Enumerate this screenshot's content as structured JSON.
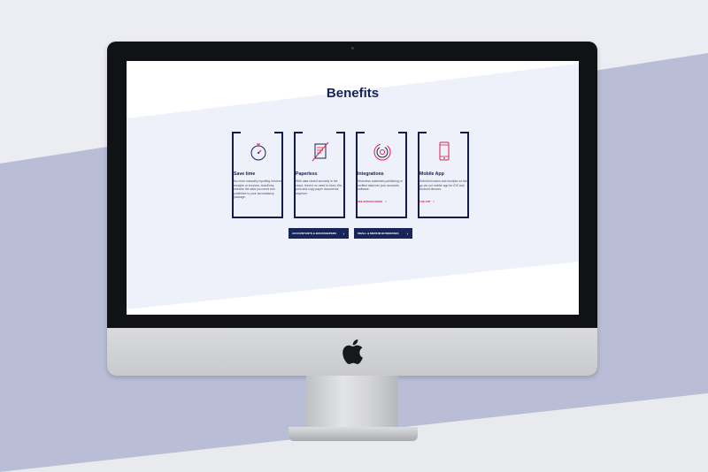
{
  "screen": {
    "heading": "Benefits",
    "cards": [
      {
        "title": "Save time",
        "text": "No more manually inputting invoices, receipts or invoices. AutoEntry extracts the data you need and publishes to your accountancy package.",
        "icon": "stopwatch-icon",
        "link": ""
      },
      {
        "title": "Paperless",
        "text": "With data stored securely in the cloud, there's no need to store, file, print and copy paper documents anymore",
        "icon": "document-icon",
        "link": ""
      },
      {
        "title": "Integrations",
        "text": "Seamless automatic publishing of verified data into your accounts software.",
        "icon": "sync-icon",
        "link": "SEE INTEGRATIONS"
      },
      {
        "title": "Mobile App",
        "text": "Submit invoices and receipts on-the-go via our mobile app for iOS and Android devices.",
        "icon": "mobile-phone-icon",
        "link": "THE APP"
      }
    ],
    "buttons": [
      {
        "label": "ACCOUNTANTS & BOOKKEEPERS"
      },
      {
        "label": "SMALL & MEDIUM BUSINESSES"
      }
    ]
  },
  "colors": {
    "accent": "#d7234d",
    "brand_navy": "#16225a",
    "backdrop_band": "#b9bdd6"
  }
}
